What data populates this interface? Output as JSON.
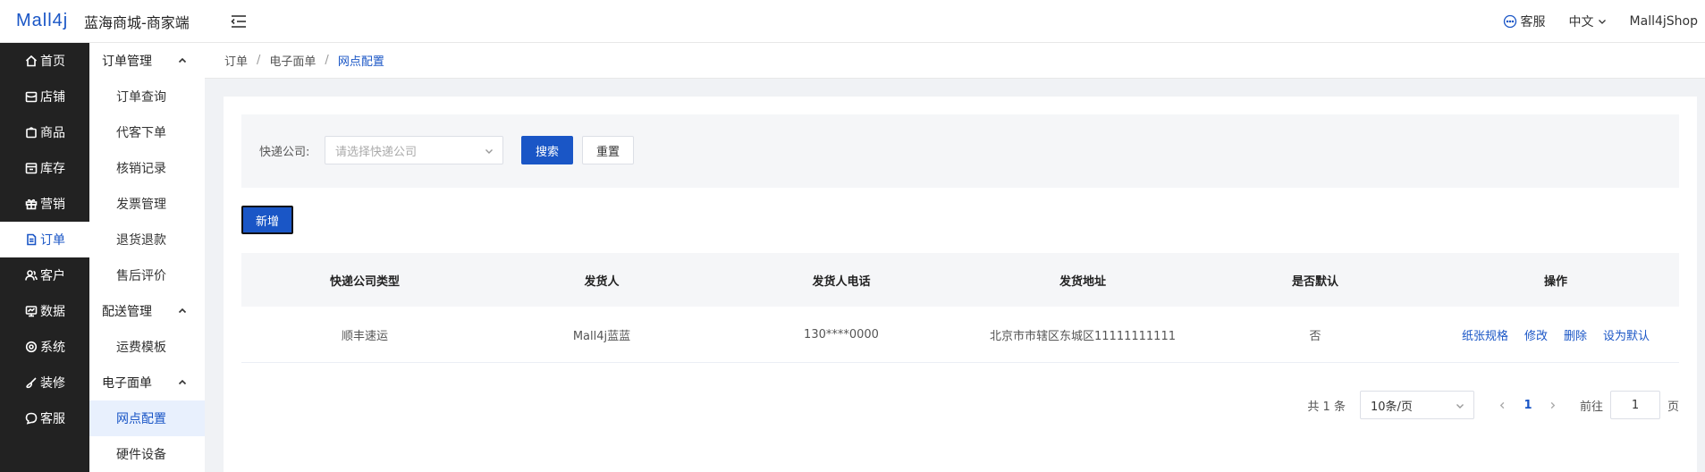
{
  "header": {
    "logo": "Mall4j",
    "title": "蓝海商城-商家端",
    "customer_service": "客服",
    "language": "中文",
    "user": "Mall4jShop"
  },
  "sidebar": {
    "items": [
      {
        "label": "首页",
        "icon": "home-icon"
      },
      {
        "label": "店铺",
        "icon": "shop-icon"
      },
      {
        "label": "商品",
        "icon": "product-icon"
      },
      {
        "label": "库存",
        "icon": "inventory-icon"
      },
      {
        "label": "营销",
        "icon": "gift-icon"
      },
      {
        "label": "订单",
        "icon": "document-icon"
      },
      {
        "label": "客户",
        "icon": "users-icon"
      },
      {
        "label": "数据",
        "icon": "chart-icon"
      },
      {
        "label": "系统",
        "icon": "gear-icon"
      },
      {
        "label": "装修",
        "icon": "brush-icon"
      },
      {
        "label": "客服",
        "icon": "chat-icon"
      }
    ]
  },
  "submenu": {
    "group1": "订单管理",
    "items1": [
      "订单查询",
      "代客下单",
      "核销记录",
      "发票管理",
      "退货退款",
      "售后评价"
    ],
    "group2": "配送管理",
    "items2": [
      "运费模板"
    ],
    "group3": "电子面单",
    "items3": [
      "网点配置",
      "硬件设备"
    ]
  },
  "breadcrumb": [
    "订单",
    "电子面单",
    "网点配置"
  ],
  "search": {
    "label": "快递公司:",
    "placeholder": "请选择快递公司",
    "search_btn": "搜索",
    "reset_btn": "重置"
  },
  "add_btn": "新增",
  "table": {
    "headers": [
      "快递公司类型",
      "发货人",
      "发货人电话",
      "发货地址",
      "是否默认",
      "操作"
    ],
    "rows": [
      {
        "company": "顺丰速运",
        "sender": "Mall4j蓝蓝",
        "phone": "130****0000",
        "address": "北京市市辖区东城区11111111111",
        "is_default": "否",
        "ops": [
          "纸张规格",
          "修改",
          "删除",
          "设为默认"
        ]
      }
    ]
  },
  "pagination": {
    "total": "共 1 条",
    "page_size": "10条/页",
    "current": "1",
    "goto": "前往",
    "jump_value": "1",
    "unit": "页"
  },
  "colors": {
    "primary": "#1a56c6",
    "sidebar_bg": "#222222"
  }
}
